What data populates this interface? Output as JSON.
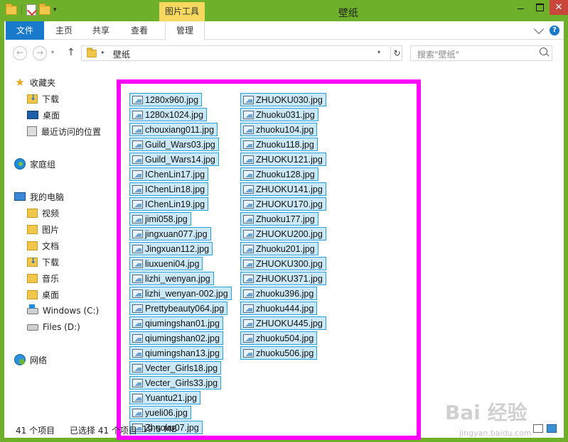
{
  "window": {
    "title": "壁纸",
    "contextual_group": "图片工具",
    "controls": {
      "minimize": "",
      "maximize": "",
      "close": "✕"
    }
  },
  "ribbon": {
    "tabs": [
      {
        "label": "文件"
      },
      {
        "label": "主页"
      },
      {
        "label": "共享"
      },
      {
        "label": "查看"
      },
      {
        "label": "管理"
      }
    ],
    "help": "?"
  },
  "address": {
    "back": "←",
    "forward": "→",
    "up": "↑",
    "path": "壁纸",
    "refresh": "↻",
    "search_placeholder": "搜索\"壁纸\""
  },
  "sidebar": {
    "items": [
      {
        "label": "收藏夹",
        "icon": "star-icon"
      },
      {
        "label": "下载",
        "icon": "downloads-folder-icon"
      },
      {
        "label": "桌面",
        "icon": "desktop-icon"
      },
      {
        "label": "最近访问的位置",
        "icon": "recent-places-icon"
      },
      {
        "label": "家庭组",
        "icon": "homegroup-icon"
      },
      {
        "label": "我的电脑",
        "icon": "computer-icon"
      },
      {
        "label": "视频",
        "icon": "folder-icon"
      },
      {
        "label": "图片",
        "icon": "folder-icon"
      },
      {
        "label": "文档",
        "icon": "folder-icon"
      },
      {
        "label": "下载",
        "icon": "downloads-folder-icon"
      },
      {
        "label": "音乐",
        "icon": "folder-icon"
      },
      {
        "label": "桌面",
        "icon": "folder-icon"
      },
      {
        "label": "Windows (C:)",
        "icon": "windows-drive-icon"
      },
      {
        "label": "Files (D:)",
        "icon": "drive-icon"
      },
      {
        "label": "网络",
        "icon": "network-icon"
      }
    ]
  },
  "files": {
    "column1": [
      "1280x960.jpg",
      "1280x1024.jpg",
      "chouxiang011.jpg",
      "Guild_Wars03.jpg",
      "Guild_Wars14.jpg",
      "IChenLin17.jpg",
      "IChenLin18.jpg",
      "IChenLin19.jpg",
      "jimi058.jpg",
      "jingxuan077.jpg",
      "Jingxuan112.jpg",
      "liuxueni04.jpg",
      "lizhi_wenyan.jpg",
      "lizhi_wenyan-002.jpg",
      "Prettybeauty064.jpg",
      "qiumingshan01.jpg",
      "qiumingshan02.jpg",
      "qiumingshan13.jpg",
      "Vecter_Girls18.jpg",
      "Vecter_Girls33.jpg",
      "Yuantu21.jpg",
      "yueli06.jpg",
      "Zhuoku07.jpg"
    ],
    "column2": [
      "ZHUOKU030.jpg",
      "Zhuoku031.jpg",
      "zhuoku104.jpg",
      "Zhuoku118.jpg",
      "ZHUOKU121.jpg",
      "Zhuoku128.jpg",
      "ZHUOKU141.jpg",
      "ZHUOKU170.jpg",
      "Zhuoku177.jpg",
      "ZHUOKU200.jpg",
      "Zhuoku201.jpg",
      "ZHUOKU300.jpg",
      "ZHUOKU371.jpg",
      "zhuoku396.jpg",
      "zhuoku444.jpg",
      "ZHUOKU445.jpg",
      "zhuoku504.jpg",
      "zhuoku506.jpg"
    ]
  },
  "status": {
    "count": "41 个项目",
    "selected": "已选择 41 个项目",
    "size": "19.5 MB"
  },
  "watermark": {
    "text": "Bai 经验",
    "url": "jingyan.baidu.com"
  },
  "colors": {
    "frame": "#6fb02a",
    "file_tab": "#1979ca",
    "contextual": "#f7d85e",
    "selection_fill": "#cbe8f6",
    "selection_border": "#26a0da",
    "highlight_box": "#ff00ff",
    "close_button": "#c9463d"
  }
}
